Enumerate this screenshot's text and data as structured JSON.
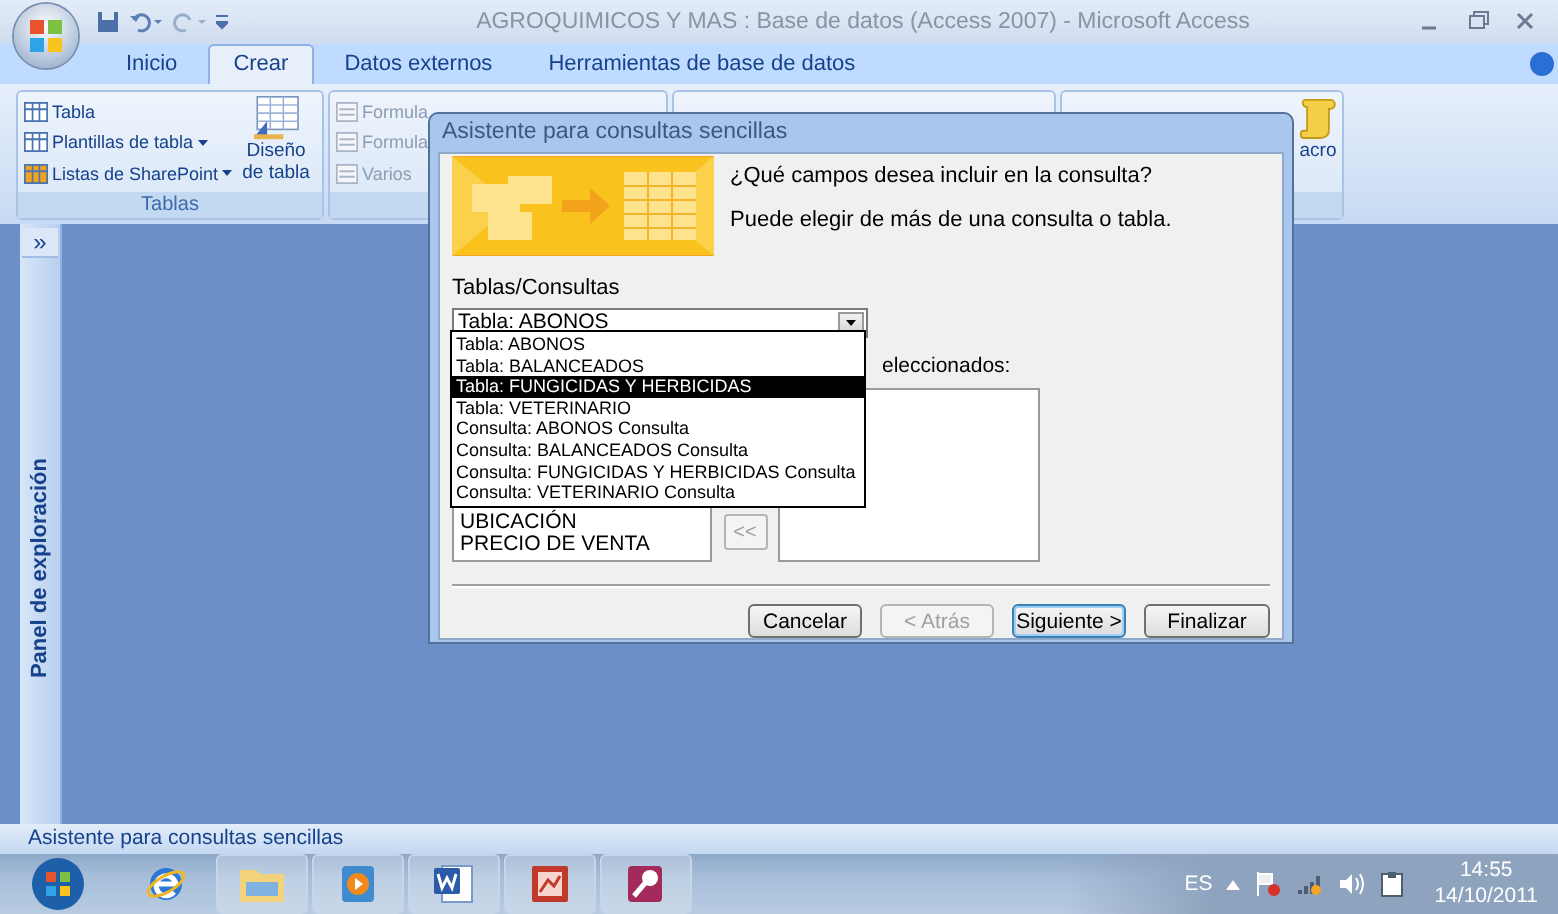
{
  "window": {
    "title": "AGROQUIMICOS Y MAS : Base de datos (Access 2007) - Microsoft Access"
  },
  "ribbon_tabs": [
    {
      "label": "Inicio",
      "selected": false
    },
    {
      "label": "Crear",
      "selected": true
    },
    {
      "label": "Datos externos",
      "selected": false
    },
    {
      "label": "Herramientas de base de datos",
      "selected": false
    }
  ],
  "ribbon": {
    "tablas_group": {
      "label": "Tablas",
      "items": [
        {
          "label": "Tabla",
          "dropdown": false
        },
        {
          "label": "Plantillas de tabla",
          "dropdown": true
        },
        {
          "label": "Listas de SharePoint",
          "dropdown": true
        }
      ],
      "big_button": "Diseño de tabla"
    },
    "forms_group": {
      "items": [
        {
          "label": "Formula",
          "disabled": true
        },
        {
          "label": "Formula",
          "disabled": true
        },
        {
          "label": "Varios",
          "disabled": true
        }
      ]
    },
    "macro_group": {
      "label": "acro"
    }
  },
  "nav_pane": {
    "toggle": "»",
    "title": "Panel de exploración"
  },
  "dialog": {
    "title": "Asistente para consultas sencillas",
    "question": "¿Qué campos desea incluir en la consulta?",
    "hint": "Puede elegir de más de una consulta o tabla.",
    "combo_label": "Tablas/Consultas",
    "combo_value": "Tabla: ABONOS",
    "options": [
      {
        "label": "Tabla: ABONOS",
        "selected": false
      },
      {
        "label": "Tabla: BALANCEADOS",
        "selected": false
      },
      {
        "label": "Tabla: FUNGICIDAS Y HERBICIDAS",
        "selected": true
      },
      {
        "label": "Tabla: VETERINARIO",
        "selected": false
      },
      {
        "label": "Consulta: ABONOS Consulta",
        "selected": false
      },
      {
        "label": "Consulta: BALANCEADOS Consulta",
        "selected": false
      },
      {
        "label": "Consulta: FUNGICIDAS Y HERBICIDAS Consulta",
        "selected": false
      },
      {
        "label": "Consulta: VETERINARIO Consulta",
        "selected": false
      }
    ],
    "selected_fields_label": "eleccionados:",
    "available_fields": [
      "UBICACIÓN",
      "PRECIO DE VENTA"
    ],
    "remove_all_button": "<<",
    "buttons": [
      {
        "label": "Cancelar",
        "disabled": false,
        "default": false
      },
      {
        "label": "< Atrás",
        "disabled": true,
        "default": false
      },
      {
        "label": "Siguiente >",
        "disabled": false,
        "default": true
      },
      {
        "label": "Finalizar",
        "disabled": false,
        "default": false
      }
    ]
  },
  "status_bar": "Asistente para consultas sencillas",
  "taskbar": {
    "apps": [
      {
        "kind": "browser"
      },
      {
        "kind": "folder"
      },
      {
        "kind": "media"
      },
      {
        "kind": "word"
      },
      {
        "kind": "presentation"
      },
      {
        "kind": "access"
      }
    ],
    "language": "ES",
    "time": "14:55",
    "date": "14/10/2011"
  }
}
